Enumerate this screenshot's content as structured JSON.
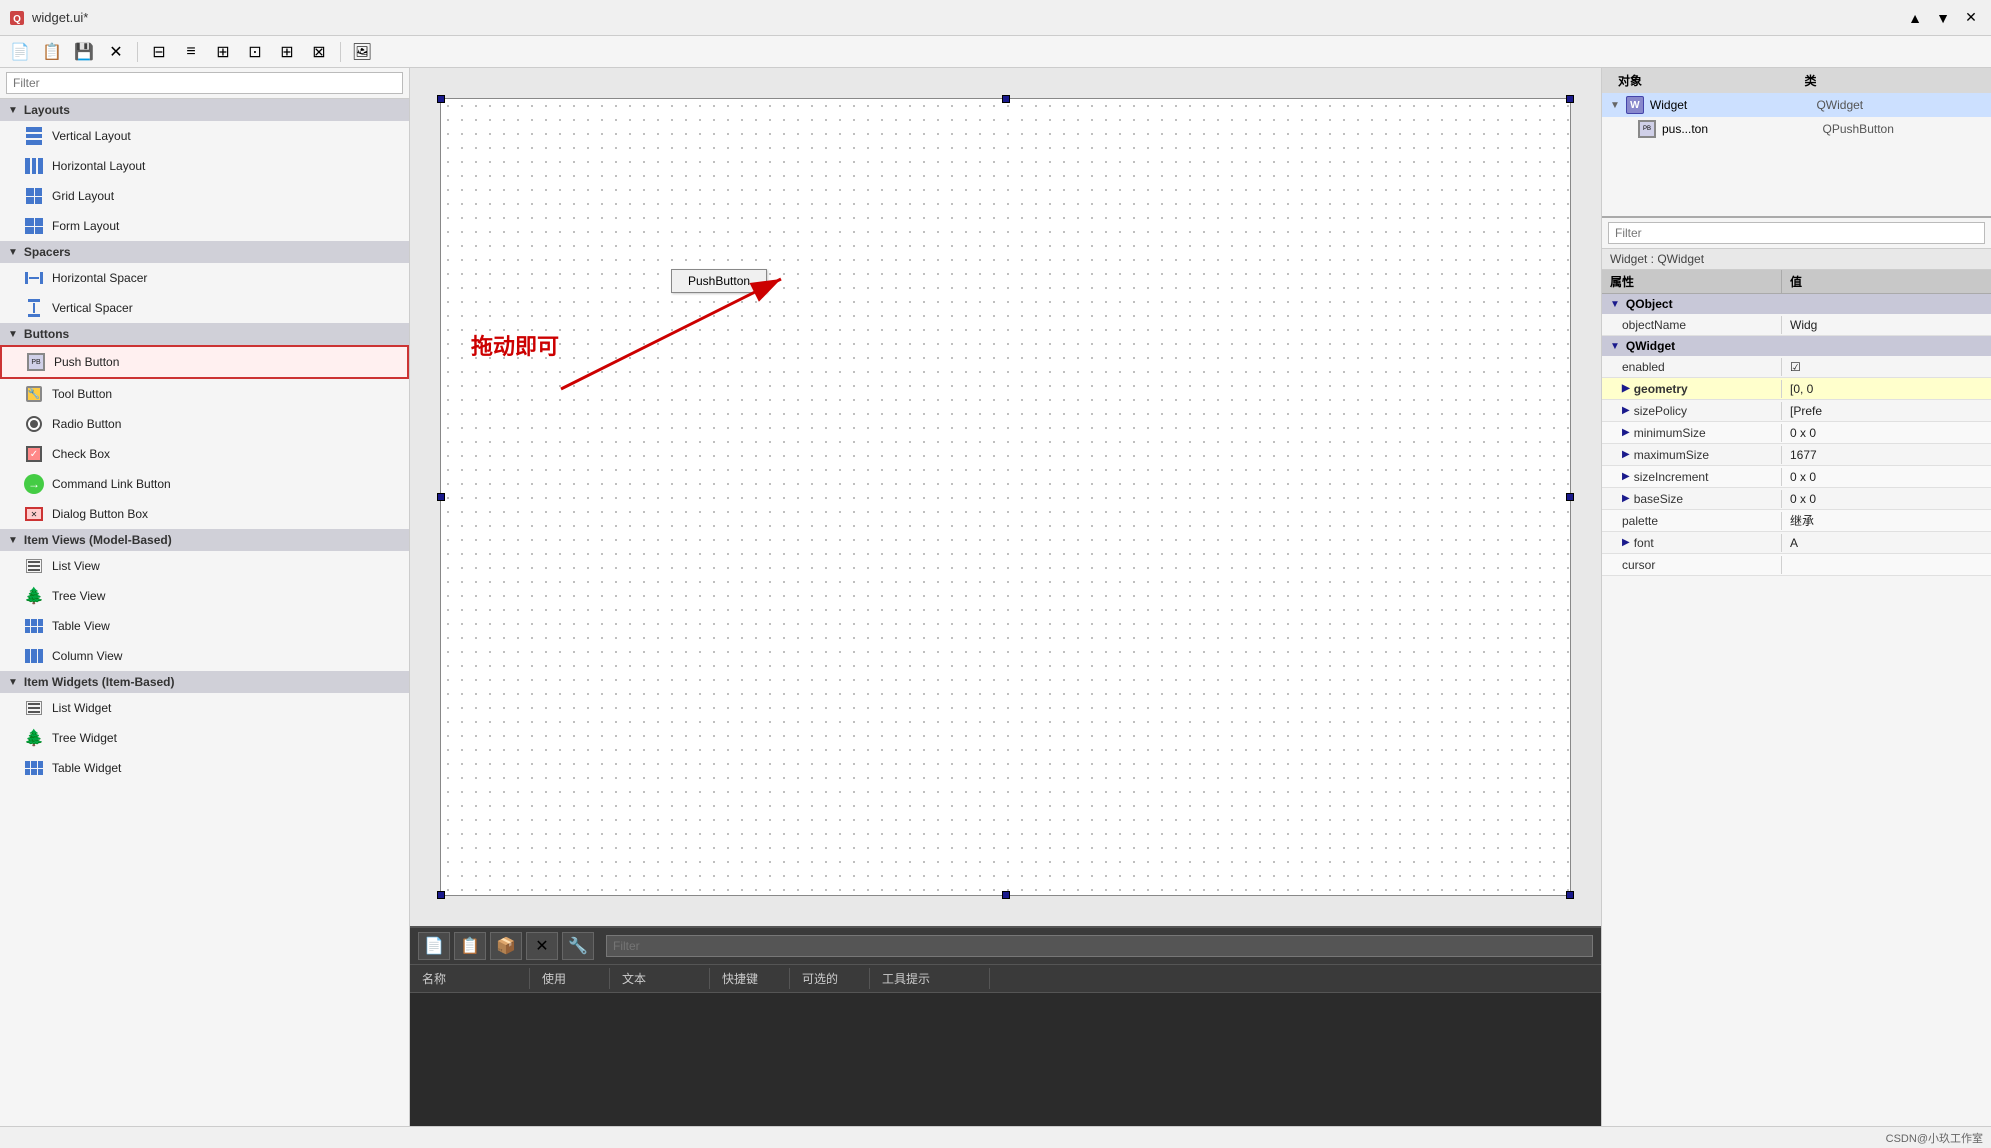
{
  "titlebar": {
    "title": "widget.ui*",
    "close_label": "✕",
    "min_label": "─",
    "max_label": "□"
  },
  "toolbar": {
    "buttons": [
      "📄",
      "📋",
      "💾",
      "✕",
      "🔧",
      "▐▌",
      "≡",
      "⊟",
      "⊞",
      "⊡",
      "⊞",
      "⊠",
      "🖼"
    ]
  },
  "widget_panel": {
    "filter_placeholder": "Filter",
    "sections": [
      {
        "name": "Layouts",
        "items": [
          {
            "label": "Vertical Layout",
            "icon": "layout-vert"
          },
          {
            "label": "Horizontal Layout",
            "icon": "layout-horiz"
          },
          {
            "label": "Grid Layout",
            "icon": "icon-grid"
          },
          {
            "label": "Form Layout",
            "icon": "layout-form"
          }
        ]
      },
      {
        "name": "Spacers",
        "items": [
          {
            "label": "Horizontal Spacer",
            "icon": "hspacer"
          },
          {
            "label": "Vertical Spacer",
            "icon": "vspacer"
          }
        ]
      },
      {
        "name": "Buttons",
        "items": [
          {
            "label": "Push Button",
            "icon": "push-btn",
            "selected": true
          },
          {
            "label": "Tool Button",
            "icon": "tool-btn"
          },
          {
            "label": "Radio Button",
            "icon": "radio-btn"
          },
          {
            "label": "Check Box",
            "icon": "check-box"
          },
          {
            "label": "Command Link Button",
            "icon": "cmd-link"
          },
          {
            "label": "Dialog Button Box",
            "icon": "dialog-btn"
          }
        ]
      },
      {
        "name": "Item Views (Model-Based)",
        "items": [
          {
            "label": "List View",
            "icon": "list-view"
          },
          {
            "label": "Tree View",
            "icon": "tree-view"
          },
          {
            "label": "Table View",
            "icon": "table-view"
          },
          {
            "label": "Column View",
            "icon": "col-view"
          }
        ]
      },
      {
        "name": "Item Widgets (Item-Based)",
        "items": [
          {
            "label": "List Widget",
            "icon": "list-widget"
          },
          {
            "label": "Tree Widget",
            "icon": "tree-widget"
          },
          {
            "label": "Table Widget",
            "icon": "table-widget"
          }
        ]
      }
    ]
  },
  "canvas": {
    "push_button_label": "PushButton",
    "annotation_text": "拖动即可"
  },
  "action_panel": {
    "filter_placeholder": "Filter",
    "columns": [
      "名称",
      "使用",
      "文本",
      "快捷键",
      "可选的",
      "工具提示"
    ]
  },
  "object_inspector": {
    "title_obj": "对象",
    "title_class": "类",
    "rows": [
      {
        "expand": true,
        "name": "Widget",
        "type": "QWidget",
        "level": 0
      },
      {
        "expand": false,
        "name": "pus...ton",
        "type": "QPushButton",
        "level": 1
      }
    ]
  },
  "properties": {
    "filter_placeholder": "Filter",
    "context": "Widget : QWidget",
    "label_attr": "属性",
    "label_val": "值",
    "sections": [
      {
        "name": "QObject",
        "rows": [
          {
            "name": "objectName",
            "value": "Widg",
            "bold": false
          }
        ]
      },
      {
        "name": "QWidget",
        "rows": [
          {
            "name": "enabled",
            "value": "☑",
            "bold": false
          },
          {
            "name": "geometry",
            "value": "[0, 0",
            "bold": true
          },
          {
            "name": "sizePolicy",
            "value": "[Prefe",
            "bold": false
          },
          {
            "name": "minimumSize",
            "value": "0 x 0",
            "bold": false
          },
          {
            "name": "maximumSize",
            "value": "1677",
            "bold": false
          },
          {
            "name": "sizeIncrement",
            "value": "0 x 0",
            "bold": false
          },
          {
            "name": "baseSize",
            "value": "0 x 0",
            "bold": false
          },
          {
            "name": "palette",
            "value": "继承",
            "bold": false
          },
          {
            "name": "font",
            "value": "A",
            "bold": false
          },
          {
            "name": "cursor",
            "value": "",
            "bold": false
          }
        ]
      }
    ]
  },
  "statusbar": {
    "text": "CSDN@小玖工作室"
  }
}
